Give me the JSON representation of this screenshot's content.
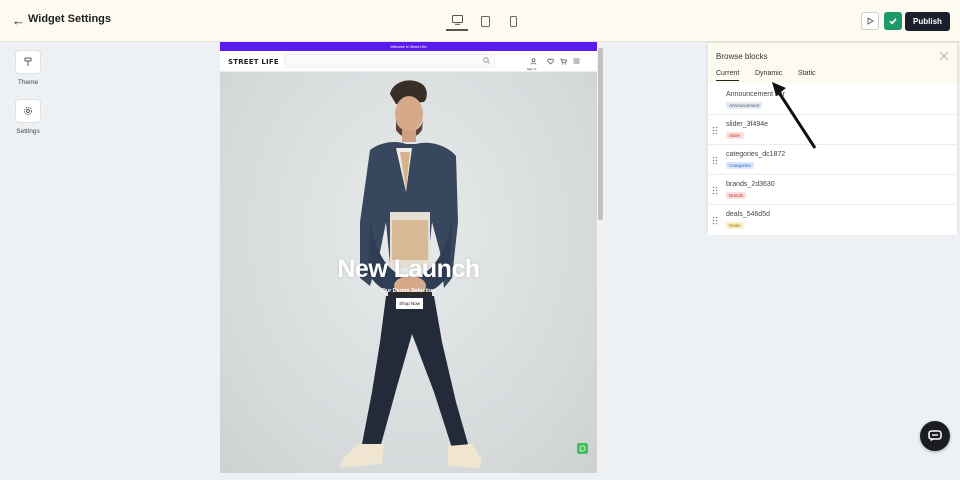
{
  "app": {
    "title": "Widget Settings",
    "publish_label": "Publish"
  },
  "devices": [
    "desktop",
    "tablet",
    "mobile"
  ],
  "rail": {
    "items": [
      {
        "label": "Theme",
        "icon": "paint-roller-icon"
      },
      {
        "label": "Settings",
        "icon": "gear-icon"
      }
    ]
  },
  "preview": {
    "announcement": "Welcome to Street Life!",
    "brand": "STREET LIFE",
    "signin_label": "Sign In",
    "hero": {
      "title": "New Launch",
      "subtitle": "Our Denim Selection",
      "cta": "Shop Now"
    }
  },
  "panel": {
    "title": "Browse blocks",
    "tabs": [
      "Current",
      "Dynamic",
      "Static"
    ],
    "active_tab": "Current",
    "blocks": [
      {
        "name": "Announcement bar",
        "tag": "Announcement",
        "tag_bg": "#e6ebf2",
        "tag_fg": "#4a5568"
      },
      {
        "name": "slider_3f494e",
        "tag": "Slider",
        "tag_bg": "#fbe0e0",
        "tag_fg": "#c0392b"
      },
      {
        "name": "categories_dc1872",
        "tag": "Categories",
        "tag_bg": "#dbe7fb",
        "tag_fg": "#2f6bc8"
      },
      {
        "name": "brands_2d3630",
        "tag": "Brands",
        "tag_bg": "#fbe0e0",
        "tag_fg": "#c0392b"
      },
      {
        "name": "deals_546d5d",
        "tag": "Deals",
        "tag_bg": "#fdf0c6",
        "tag_fg": "#9a7410"
      }
    ]
  },
  "colors": {
    "accent": "#5a1bf0",
    "publish": "#1d1f2c",
    "check": "#1c9a6a",
    "whatsapp": "#3fbf5a"
  }
}
